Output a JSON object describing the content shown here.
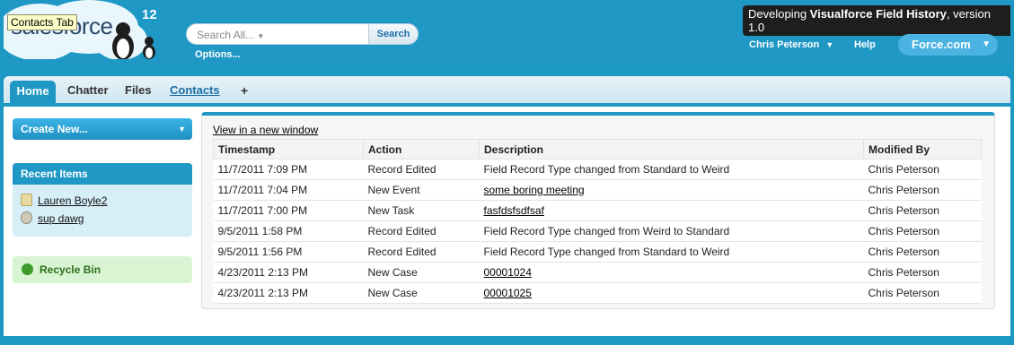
{
  "tooltip": "Contacts Tab",
  "logo": {
    "text": "salesforce",
    "version": "12"
  },
  "search": {
    "placeholder": "Search All...",
    "button_label": "Search",
    "options_label": "Options..."
  },
  "banner": {
    "prefix": "Developing ",
    "bold": "Visualforce Field History",
    "suffix": ", version 1.0"
  },
  "user_menu": {
    "name": "Chris Peterson"
  },
  "help_label": "Help",
  "app_menu": {
    "label": "Force.com"
  },
  "tabs": [
    {
      "label": "Home"
    },
    {
      "label": "Chatter"
    },
    {
      "label": "Files"
    },
    {
      "label": "Contacts"
    },
    {
      "label": "+"
    }
  ],
  "sidebar": {
    "create_new_label": "Create New...",
    "recent_items_title": "Recent Items",
    "recent_items": [
      {
        "label": "Lauren Boyle2",
        "icon": "contact-icon"
      },
      {
        "label": "sup dawg",
        "icon": "record-icon"
      }
    ],
    "recycle_bin_label": "Recycle Bin"
  },
  "main": {
    "new_window_link": "View in a new window",
    "table": {
      "headers": [
        "Timestamp",
        "Action",
        "Description",
        "Modified By"
      ],
      "rows": [
        {
          "timestamp": "11/7/2011 7:09 PM",
          "action": "Record Edited",
          "description": "Field Record Type changed from Standard to Weird",
          "description_link": false,
          "modified_by": "Chris Peterson"
        },
        {
          "timestamp": "11/7/2011 7:04 PM",
          "action": "New Event",
          "description": "some boring meeting",
          "description_link": true,
          "modified_by": "Chris Peterson"
        },
        {
          "timestamp": "11/7/2011 7:00 PM",
          "action": "New Task",
          "description": "fasfdsfsdfsaf",
          "description_link": true,
          "modified_by": "Chris Peterson"
        },
        {
          "timestamp": "9/5/2011 1:58 PM",
          "action": "Record Edited",
          "description": "Field Record Type changed from Weird to Standard",
          "description_link": false,
          "modified_by": "Chris Peterson"
        },
        {
          "timestamp": "9/5/2011 1:56 PM",
          "action": "Record Edited",
          "description": "Field Record Type changed from Standard to Weird",
          "description_link": false,
          "modified_by": "Chris Peterson"
        },
        {
          "timestamp": "4/23/2011 2:13 PM",
          "action": "New Case",
          "description": "00001024",
          "description_link": true,
          "modified_by": "Chris Peterson"
        },
        {
          "timestamp": "4/23/2011 2:13 PM",
          "action": "New Case",
          "description": "00001025",
          "description_link": true,
          "modified_by": "Chris Peterson"
        }
      ]
    }
  },
  "colors": {
    "brand_blue": "#1f98c5",
    "recycle_green": "#d9f4d2",
    "recent_bg": "#d6eef8"
  }
}
